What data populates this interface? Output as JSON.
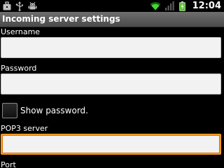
{
  "status_bar": {
    "clock": "12:04",
    "left_icons": [
      "briefcase-icon",
      "usb-icon",
      "android-debug-icon"
    ],
    "right_icons": [
      "wifi-icon",
      "signal-icon",
      "battery-charging-icon"
    ]
  },
  "title_bar": {
    "title": "Incoming server settings"
  },
  "form": {
    "username": {
      "label": "Username",
      "value": ""
    },
    "password": {
      "label": "Password",
      "value": ""
    },
    "show_password": {
      "label": "Show password.",
      "checked": false
    },
    "pop3_server": {
      "label": "POP3 server",
      "value": "",
      "focused": true
    },
    "port": {
      "label": "Port"
    }
  },
  "colors": {
    "focus_accent": "#ff9a1f",
    "wifi_green": "#3ddc2f",
    "battery_green": "#5ac82a",
    "background": "#000000",
    "field_background": "#f2f2f2"
  }
}
